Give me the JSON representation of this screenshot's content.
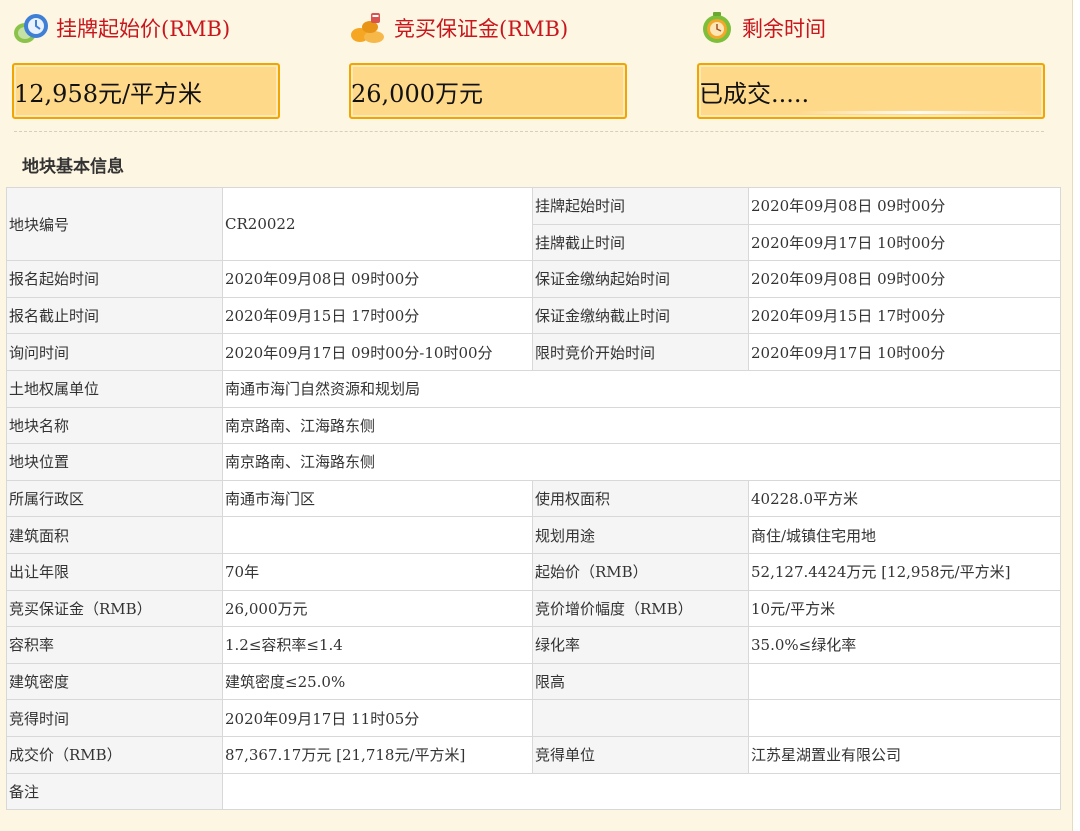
{
  "header": {
    "start_price_label": "挂牌起始价(RMB)",
    "deposit_label": "竞买保证金(RMB)",
    "remaining_label": "剩余时间",
    "start_price_value": "12,958元/平方米",
    "deposit_value": "26,000万元",
    "remaining_value": "已成交....."
  },
  "section": {
    "title": "地块基本信息"
  },
  "table": {
    "r1": {
      "l1": "地块编号",
      "v1": "CR20022",
      "l2": "挂牌起始时间",
      "v2": "2020年09月08日 09时00分"
    },
    "r2": {
      "l2": "挂牌截止时间",
      "v2": "2020年09月17日 10时00分"
    },
    "r3": {
      "l1": "报名起始时间",
      "v1": "2020年09月08日 09时00分",
      "l2": "保证金缴纳起始时间",
      "v2": "2020年09月08日 09时00分"
    },
    "r4": {
      "l1": "报名截止时间",
      "v1": "2020年09月15日 17时00分",
      "l2": "保证金缴纳截止时间",
      "v2": "2020年09月15日 17时00分"
    },
    "r5": {
      "l1": "询问时间",
      "v1": "2020年09月17日 09时00分-10时00分",
      "l2": "限时竞价开始时间",
      "v2": "2020年09月17日 10时00分"
    },
    "r6": {
      "l1": "土地权属单位",
      "v1": "南通市海门自然资源和规划局"
    },
    "r7": {
      "l1": "地块名称",
      "v1": "南京路南、江海路东侧"
    },
    "r8": {
      "l1": "地块位置",
      "v1": "南京路南、江海路东侧"
    },
    "r9": {
      "l1": "所属行政区",
      "v1": "南通市海门区",
      "l2": "使用权面积",
      "v2": "40228.0平方米"
    },
    "r10": {
      "l1": "建筑面积",
      "v1": "",
      "l2": "规划用途",
      "v2": "商住/城镇住宅用地"
    },
    "r11": {
      "l1": "出让年限",
      "v1": "70年",
      "l2": "起始价（RMB）",
      "v2": "52,127.4424万元 [12,958元/平方米]"
    },
    "r12": {
      "l1": "竞买保证金（RMB）",
      "v1": "26,000万元",
      "l2": "竞价增价幅度（RMB）",
      "v2": "10元/平方米"
    },
    "r13": {
      "l1": "容积率",
      "v1": "1.2≤容积率≤1.4",
      "l2": "绿化率",
      "v2": "35.0%≤绿化率"
    },
    "r14": {
      "l1": "建筑密度",
      "v1": "建筑密度≤25.0%",
      "l2": "限高",
      "v2": ""
    },
    "r15": {
      "l1": "竞得时间",
      "v1": "2020年09月17日 11时05分",
      "l2": "",
      "v2": ""
    },
    "r16": {
      "l1": "成交价（RMB）",
      "v1": "87,367.17万元 [21,718元/平方米]",
      "l2": "竞得单位",
      "v2": "江苏星湖置业有限公司"
    },
    "r17": {
      "l1": "备注",
      "v1": ""
    }
  },
  "icons": {
    "start_price": "price-icon",
    "deposit": "deposit-icon",
    "remaining": "clock-icon"
  }
}
